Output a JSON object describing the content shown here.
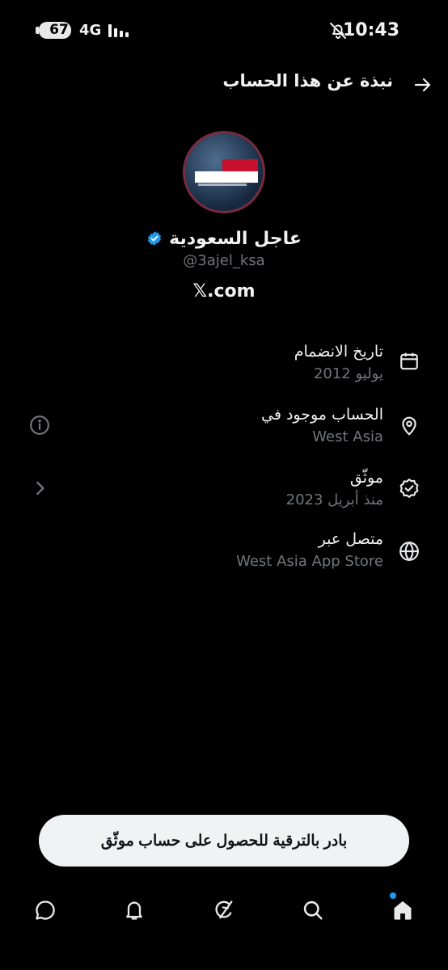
{
  "status_bar": {
    "battery": "67",
    "network": "4G",
    "time": "10:43"
  },
  "header": {
    "title": "نبذة عن هذا الحساب"
  },
  "profile": {
    "display_name": "عاجل السعودية",
    "handle": "@3ajel_ksa",
    "website": "𝕏.com",
    "avatar_text": "عاجل السعودية"
  },
  "info": [
    {
      "label": "تاريخ الانضمام",
      "value": "يوليو 2012",
      "icon": "calendar-icon"
    },
    {
      "label": "الحساب موجود في",
      "value": "West Asia",
      "icon": "location-pin-icon",
      "side_icon": "info-icon"
    },
    {
      "label": "موثّق",
      "value": "منذ أبريل 2023",
      "icon": "verified-outline-icon",
      "side_icon": "chevron-right-icon"
    },
    {
      "label": "متصل عبر",
      "value": "West Asia App Store",
      "icon": "globe-icon"
    }
  ],
  "upgrade": {
    "label": "بادر بالترقية للحصول على حساب موثّق"
  },
  "nav": [
    "chat-icon",
    "bell-icon",
    "grok-icon",
    "search-icon",
    "home-icon"
  ],
  "colors": {
    "background": "#000000",
    "accent": "#1d9bf0",
    "muted": "#71767b",
    "button_bg": "#eff3f4"
  }
}
